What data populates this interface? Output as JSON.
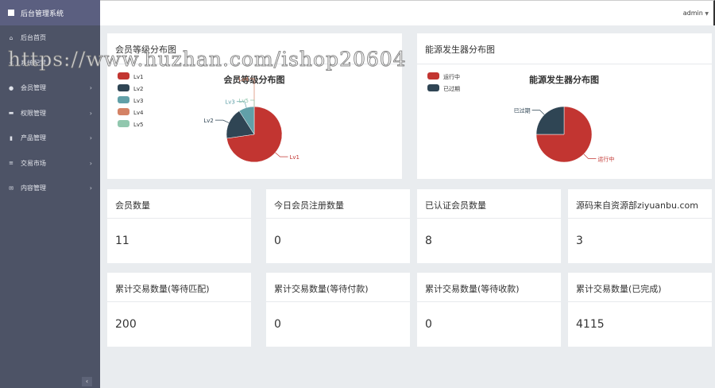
{
  "brand": "后台管理系统",
  "user": "admin",
  "sidebar": [
    {
      "label": "后台首页",
      "icon": "home-icon",
      "ch": false
    },
    {
      "label": "系统配置",
      "icon": "share-icon",
      "ch": false
    },
    {
      "label": "会员管理",
      "icon": "user-icon",
      "ch": true
    },
    {
      "label": "权限管理",
      "icon": "card-icon",
      "ch": true
    },
    {
      "label": "产品管理",
      "icon": "book-icon",
      "ch": true
    },
    {
      "label": "交易市场",
      "icon": "list-icon",
      "ch": true
    },
    {
      "label": "内容管理",
      "icon": "mail-icon",
      "ch": true
    }
  ],
  "watermark": "https://www.huzhan.com/ishop20604",
  "chart_data": [
    {
      "type": "pie",
      "panel_title": "会员等级分布图",
      "title": "会员等级分布图",
      "categories": [
        "Lv1",
        "Lv2",
        "Lv3",
        "Lv4",
        "Lv5"
      ],
      "values": [
        8,
        2,
        1,
        0,
        0
      ],
      "colors": [
        "#c23531",
        "#2f4554",
        "#61a0a8",
        "#d48265",
        "#91c7ae"
      ],
      "legend": "top-left"
    },
    {
      "type": "pie",
      "panel_title": "能源发生器分布图",
      "title": "能源发生器分布图",
      "categories": [
        "运行中",
        "已过期"
      ],
      "values": [
        3,
        1
      ],
      "colors": [
        "#c23531",
        "#2f4554"
      ],
      "legend": "top-left"
    }
  ],
  "stats": [
    {
      "label": "会员数量",
      "value": "11"
    },
    {
      "label": "今日会员注册数量",
      "value": "0"
    },
    {
      "label": "已认证会员数量",
      "value": "8"
    },
    {
      "label": "源码来自资源部ziyuanbu.com",
      "value": "3"
    },
    {
      "label": "累计交易数量(等待匹配)",
      "value": "200"
    },
    {
      "label": "累计交易数量(等待付款)",
      "value": "0"
    },
    {
      "label": "累计交易数量(等待收款)",
      "value": "0"
    },
    {
      "label": "累计交易数量(已完成)",
      "value": "4115"
    }
  ]
}
